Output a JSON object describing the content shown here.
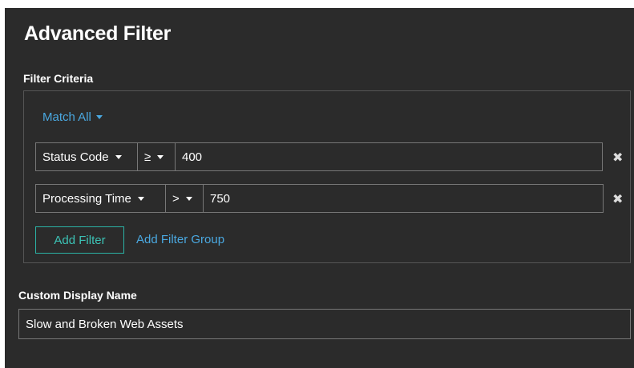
{
  "dialog": {
    "title": "Advanced Filter"
  },
  "criteria": {
    "label": "Filter Criteria",
    "match_mode": "Match All",
    "filters": [
      {
        "field": "Status Code",
        "operator": "≥",
        "value": "400"
      },
      {
        "field": "Processing Time",
        "operator": ">",
        "value": "750"
      }
    ],
    "add_filter_label": "Add Filter",
    "add_filter_group_label": "Add Filter Group"
  },
  "display_name": {
    "label": "Custom Display Name",
    "value": "Slow and Broken Web Assets"
  },
  "icons": {
    "remove": "close-icon",
    "dropdown": "caret-down-icon"
  },
  "colors": {
    "background": "#2b2b2b",
    "link": "#4aa8e0",
    "accent_button": "#2bb3a6",
    "border": "#777777"
  }
}
